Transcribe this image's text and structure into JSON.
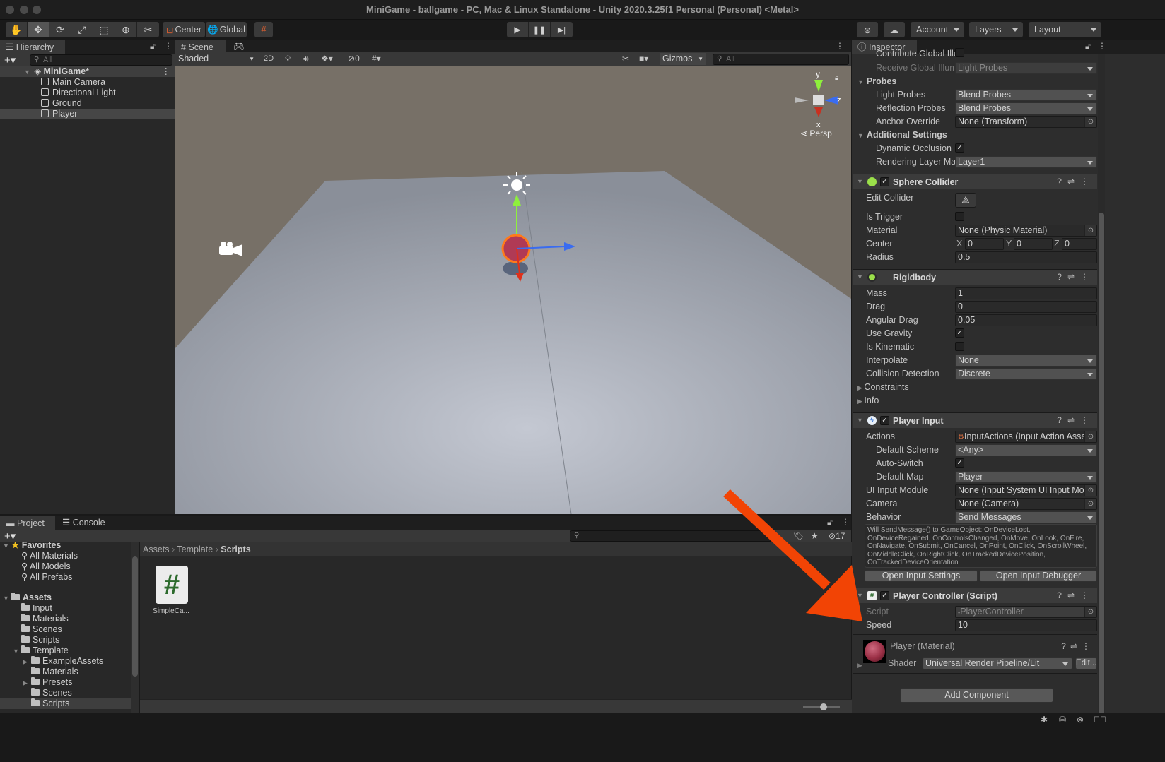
{
  "window": {
    "title": "MiniGame - ballgame - PC, Mac & Linux Standalone - Unity 2020.3.25f1 Personal (Personal) <Metal>"
  },
  "toolbar": {
    "tools": [
      "hand-tool",
      "move-tool",
      "rotate-tool",
      "scale-tool",
      "rect-tool",
      "transform-tool",
      "custom-tool"
    ],
    "pivot_label": "Center",
    "space_label": "Global",
    "account_label": "Account",
    "layers_label": "Layers",
    "layout_label": "Layout"
  },
  "hierarchy": {
    "tab_label": "Hierarchy",
    "search_placeholder": "All",
    "scene_name": "MiniGame*",
    "items": [
      {
        "label": "Main Camera"
      },
      {
        "label": "Directional Light"
      },
      {
        "label": "Ground"
      },
      {
        "label": "Player",
        "selected": true
      }
    ]
  },
  "scene_view": {
    "tabs": [
      {
        "label": "Scene",
        "active": true
      },
      {
        "label": "Game",
        "active": false
      }
    ],
    "shading_mode": "Shaded",
    "mode_2d_label": "2D",
    "hidden_count": "0",
    "gizmos_label": "Gizmos",
    "search_placeholder": "All",
    "projection_label": "Persp",
    "axis_labels": {
      "x": "x",
      "y": "y",
      "z": "z"
    }
  },
  "inspector": {
    "tab_label": "Inspector",
    "mesh_renderer_rows": [
      {
        "label": "Contribute Global Illu",
        "type": "checkbox",
        "checked": false
      },
      {
        "label": "Receive Global Illumi",
        "type": "dropdown",
        "value": "Light Probes",
        "disabled": true
      }
    ],
    "probes": {
      "title": "Probes",
      "light_probes": {
        "label": "Light Probes",
        "value": "Blend Probes"
      },
      "reflection_probes": {
        "label": "Reflection Probes",
        "value": "Blend Probes"
      },
      "anchor_override": {
        "label": "Anchor Override",
        "value": "None (Transform)"
      }
    },
    "additional_settings": {
      "title": "Additional Settings",
      "dynamic_occlusion": {
        "label": "Dynamic Occlusion",
        "checked": true
      },
      "rendering_layer_mask": {
        "label": "Rendering Layer Mas",
        "value": "Layer1"
      }
    },
    "sphere_collider": {
      "title": "Sphere Collider",
      "enabled": true,
      "edit_collider_label": "Edit Collider",
      "is_trigger": {
        "label": "Is Trigger",
        "checked": false
      },
      "material": {
        "label": "Material",
        "value": "None (Physic Material)"
      },
      "center": {
        "label": "Center",
        "x": "0",
        "y": "0",
        "z": "0"
      },
      "radius": {
        "label": "Radius",
        "value": "0.5"
      }
    },
    "rigidbody": {
      "title": "Rigidbody",
      "mass": {
        "label": "Mass",
        "value": "1"
      },
      "drag": {
        "label": "Drag",
        "value": "0"
      },
      "angular_drag": {
        "label": "Angular Drag",
        "value": "0.05"
      },
      "use_gravity": {
        "label": "Use Gravity",
        "checked": true
      },
      "is_kinematic": {
        "label": "Is Kinematic",
        "checked": false
      },
      "interpolate": {
        "label": "Interpolate",
        "value": "None"
      },
      "collision_detection": {
        "label": "Collision Detection",
        "value": "Discrete"
      },
      "constraints_label": "Constraints",
      "info_label": "Info"
    },
    "player_input": {
      "title": "Player Input",
      "enabled": true,
      "actions": {
        "label": "Actions",
        "value": "InputActions (Input Action Asset)"
      },
      "default_scheme": {
        "label": "Default Scheme",
        "value": "<Any>"
      },
      "auto_switch": {
        "label": "Auto-Switch",
        "checked": true
      },
      "default_map": {
        "label": "Default Map",
        "value": "Player"
      },
      "ui_input_module": {
        "label": "UI Input Module",
        "value": "None (Input System UI Input Module)"
      },
      "camera": {
        "label": "Camera",
        "value": "None (Camera)"
      },
      "behavior": {
        "label": "Behavior",
        "value": "Send Messages"
      },
      "help_text": "Will SendMessage() to GameObject: OnDeviceLost, OnDeviceRegained, OnControlsChanged, OnMove, OnLook, OnFire, OnNavigate, OnSubmit, OnCancel, OnPoint, OnClick, OnScrollWheel, OnMiddleClick, OnRightClick, OnTrackedDevicePosition, OnTrackedDeviceOrientation",
      "open_settings_label": "Open Input Settings",
      "open_debugger_label": "Open Input Debugger"
    },
    "player_controller": {
      "title": "Player Controller (Script)",
      "enabled": true,
      "script": {
        "label": "Script",
        "value": "PlayerController"
      },
      "speed": {
        "label": "Speed",
        "value": "10"
      }
    },
    "material": {
      "title": "Player (Material)",
      "shader_label": "Shader",
      "shader_value": "Universal Render Pipeline/Lit",
      "edit_label": "Edit...",
      "swatch_color": "#9a2f45"
    },
    "add_component_label": "Add Component"
  },
  "project": {
    "tabs": [
      {
        "label": "Project",
        "active": true
      },
      {
        "label": "Console",
        "active": false
      }
    ],
    "hidden_packages_count": "17",
    "favorites": {
      "title": "Favorites",
      "items": [
        "All Materials",
        "All Models",
        "All Prefabs"
      ]
    },
    "assets": {
      "title": "Assets",
      "items": [
        {
          "label": "Input",
          "depth": 1
        },
        {
          "label": "Materials",
          "depth": 1
        },
        {
          "label": "Scenes",
          "depth": 1
        },
        {
          "label": "Scripts",
          "depth": 1
        },
        {
          "label": "Template",
          "depth": 1,
          "expanded": true
        },
        {
          "label": "ExampleAssets",
          "depth": 2,
          "collapsed": true
        },
        {
          "label": "Materials",
          "depth": 2
        },
        {
          "label": "Presets",
          "depth": 2,
          "collapsed": true
        },
        {
          "label": "Scenes",
          "depth": 2
        },
        {
          "label": "Scripts",
          "depth": 2,
          "selected": true
        }
      ]
    },
    "breadcrumb": [
      "Assets",
      "Template",
      "Scripts"
    ],
    "files": [
      {
        "label": "SimpleCa...",
        "type": "csharp-script"
      }
    ]
  },
  "annotation": {
    "arrow_color": "#f24405"
  }
}
